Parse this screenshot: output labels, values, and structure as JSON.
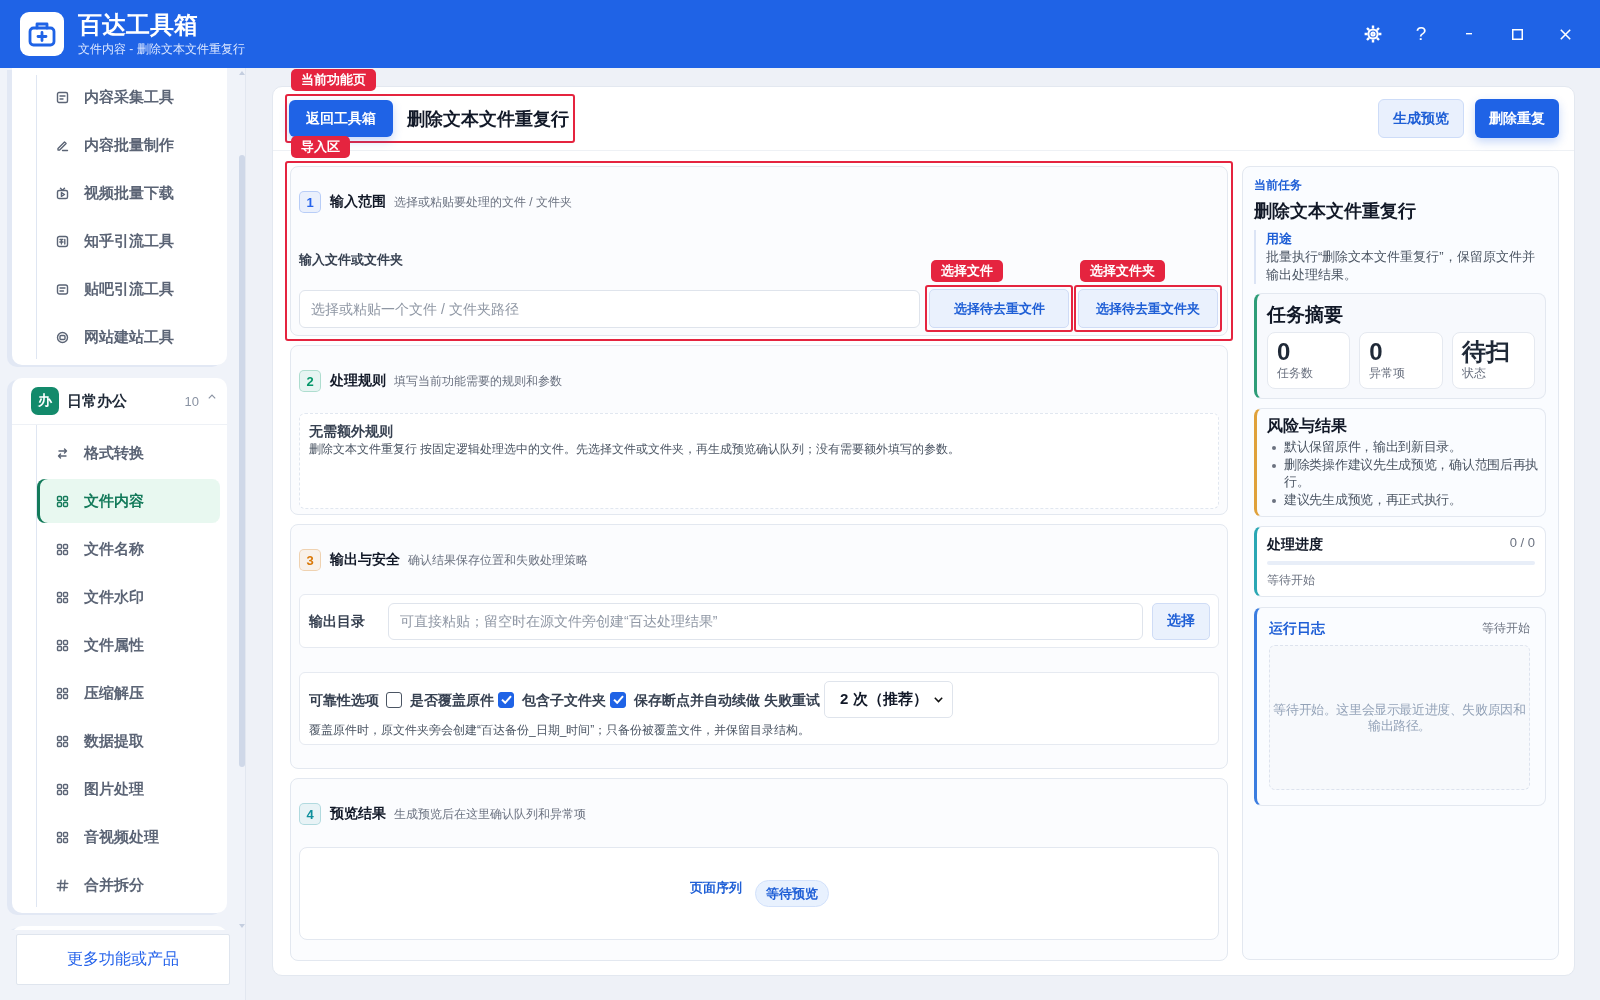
{
  "window": {
    "title": "百达工具箱",
    "subtitle": "文件内容 - 删除文本文件重复行",
    "controls": [
      {
        "kind": "settings"
      },
      {
        "kind": "help",
        "label": "?"
      },
      {
        "kind": "minimize"
      },
      {
        "kind": "maximize"
      },
      {
        "kind": "close"
      }
    ]
  },
  "sidebar": {
    "groups": [
      {
        "items": [
          {
            "kind": "form",
            "label": "内容采集工具",
            "selected": false
          },
          {
            "kind": "pen",
            "label": "内容批量制作",
            "selected": false
          },
          {
            "kind": "video",
            "label": "视频批量下载",
            "selected": false
          },
          {
            "kind": "tile",
            "label": "知乎引流工具",
            "selected": false
          },
          {
            "kind": "note",
            "label": "贴吧引流工具",
            "selected": false
          },
          {
            "kind": "ring",
            "label": "网站建站工具",
            "selected": false
          }
        ]
      },
      {
        "badge": "办",
        "title": "日常办公",
        "count": "10",
        "expanded": true,
        "color": "#138a6b",
        "items": [
          {
            "kind": "swap",
            "label": "格式转换",
            "selected": false
          },
          {
            "kind": "grid",
            "label": "文件内容",
            "selected": true
          },
          {
            "kind": "grid",
            "label": "文件名称",
            "selected": false
          },
          {
            "kind": "grid",
            "label": "文件水印",
            "selected": false
          },
          {
            "kind": "grid",
            "label": "文件属性",
            "selected": false
          },
          {
            "kind": "grid",
            "label": "压缩解压",
            "selected": false
          },
          {
            "kind": "grid",
            "label": "数据提取",
            "selected": false
          },
          {
            "kind": "grid",
            "label": "图片处理",
            "selected": false
          },
          {
            "kind": "grid",
            "label": "音视频处理",
            "selected": false
          },
          {
            "kind": "hash",
            "label": "合并拆分",
            "selected": false
          }
        ]
      }
    ],
    "more_button": "更多功能或产品"
  },
  "page": {
    "header": {
      "callout": "当前功能页",
      "back_button": "返回工具箱",
      "title": "删除文本文件重复行",
      "actions": [
        {
          "kind": "secondary",
          "label": "生成预览"
        },
        {
          "kind": "primary",
          "label": "删除重复"
        }
      ]
    },
    "sections": [
      {
        "kind": "input",
        "number": "1",
        "color": "#2563eb",
        "title": "输入范围",
        "description": "选择或粘贴要处理的文件 / 文件夹",
        "callout": "导入区",
        "field_label": "输入文件或文件夹",
        "field": {
          "placeholder": "选择或粘贴一个文件 / 文件夹路径"
        },
        "buttons": [
          {
            "label": "选择待去重文件",
            "callout": "选择文件"
          },
          {
            "label": "选择待去重文件夹",
            "callout": "选择文件夹"
          }
        ]
      },
      {
        "kind": "rules",
        "number": "2",
        "color": "#059669",
        "title": "处理规则",
        "description": "填写当前功能需要的规则和参数",
        "rule_title": "无需额外规则",
        "rule_text": "删除文本文件重复行 按固定逻辑处理选中的文件。先选择文件或文件夹，再生成预览确认队列；没有需要额外填写的参数。"
      },
      {
        "kind": "output",
        "number": "3",
        "color": "#d97706",
        "title": "输出与安全",
        "description": "确认结果保存位置和失败处理策略",
        "output_label": "输出目录",
        "output_field": {
          "placeholder": "可直接粘贴；留空时在源文件旁创建“百达处理结果”"
        },
        "choose_button": "选择",
        "options_label": "可靠性选项",
        "options": [
          {
            "label": "是否覆盖原件",
            "checked": false
          },
          {
            "label": "包含子文件夹",
            "checked": true
          },
          {
            "label": "保存断点并自动续做",
            "checked": true
          }
        ],
        "retry_label": "失败重试",
        "retry_value": "2 次（推荐）",
        "note": "覆盖原件时，原文件夹旁会创建“百达备份_日期_时间”；只备份被覆盖文件，并保留目录结构。"
      },
      {
        "kind": "preview",
        "number": "4",
        "color": "#0e8f9c",
        "title": "预览结果",
        "description": "生成预览后在这里确认队列和异常项",
        "preview_label": "页面序列",
        "preview_status": "等待预览"
      }
    ]
  },
  "task_panel": {
    "eyebrow": "当前任务",
    "title": "删除文本文件重复行",
    "purpose_label": "用途",
    "purpose_text": "批量执行“删除文本文件重复行”，保留原文件并输出处理结果。",
    "summary": {
      "title": "任务摘要",
      "stats": [
        {
          "value": "0",
          "label": "任务数"
        },
        {
          "value": "0",
          "label": "异常项"
        },
        {
          "value": "待扫",
          "label": "状态"
        }
      ]
    },
    "risks": {
      "title": "风险与结果",
      "items": [
        "默认保留原件，输出到新目录。",
        "删除类操作建议先生成预览，确认范围后再执行。",
        "建议先生成预览，再正式执行。"
      ]
    },
    "progress": {
      "title": "处理进度",
      "count": "0 / 0",
      "level": 0,
      "status": "等待开始"
    },
    "log": {
      "title": "运行日志",
      "status": "等待开始",
      "empty_text": "等待开始。这里会显示最近进度、失败原因和输出路径。"
    }
  }
}
